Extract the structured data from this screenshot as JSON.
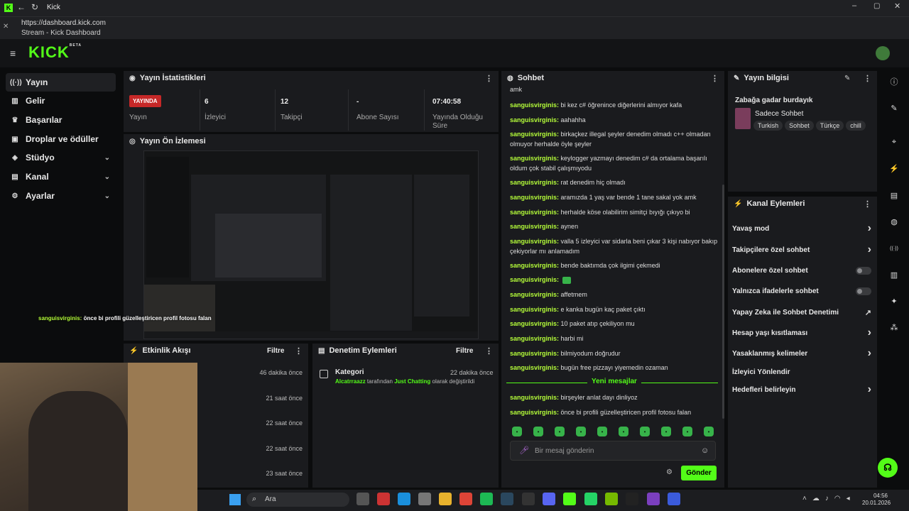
{
  "browser": {
    "tab_title": "Kick",
    "url": "https://dashboard.kick.com",
    "page_title": "Stream - Kick Dashboard"
  },
  "brand": {
    "logo": "KICK",
    "logo_sup": "BETA",
    "accent": "#53fc18"
  },
  "sidebar": {
    "items": [
      {
        "label": "Yayın",
        "icon": "broadcast-icon",
        "active": true
      },
      {
        "label": "Gelir",
        "icon": "money-icon"
      },
      {
        "label": "Başarılar",
        "icon": "trophy-icon"
      },
      {
        "label": "Droplar ve ödüller",
        "icon": "gift-icon"
      },
      {
        "label": "Stüdyo",
        "icon": "studio-icon",
        "expandable": true
      },
      {
        "label": "Kanal",
        "icon": "channel-icon",
        "expandable": true
      },
      {
        "label": "Ayarlar",
        "icon": "gear-icon",
        "expandable": true
      }
    ]
  },
  "stats": {
    "title": "Yayın İstatistikleri",
    "live_badge": "YAYINDA",
    "live_label": "Yayın",
    "items": [
      {
        "value": "6",
        "label": "İzleyici"
      },
      {
        "value": "12",
        "label": "Takipçi"
      },
      {
        "value": "-",
        "label": "Abone Sayısı"
      },
      {
        "value": "07:40:58",
        "label": "Yayında Olduğu Süre"
      }
    ]
  },
  "preview": {
    "title": "Yayın Ön İzlemesi",
    "overlay_user": "sanguisvirginis:",
    "overlay_text": "önce bi profili güzelleştiricen profil fotosu falan"
  },
  "activity": {
    "title": "Etkinlik Akışı",
    "filter": "Filtre",
    "times": [
      "46 dakika önce",
      "21 saat önce",
      "22 saat önce",
      "22 saat önce",
      "23 saat önce"
    ]
  },
  "moderation": {
    "title": "Denetim Eylemleri",
    "filter": "Filtre",
    "item_title": "Kategori",
    "item_time": "22 dakika önce",
    "actor": "Alcatrraazz",
    "mid": "tarafından",
    "target": "Just Chatting",
    "tail": "olarak değiştirildi"
  },
  "chat": {
    "title": "Sohbet",
    "first_line": "amk",
    "messages": [
      {
        "user": "sanguisvirginis:",
        "text": "bi kez c# öğrenince diğerlerini almıyor kafa"
      },
      {
        "user": "sanguisvirginis:",
        "text": "aahahha"
      },
      {
        "user": "sanguisvirginis:",
        "text": "birkaçkez illegal şeyler denedim olmadı c++ olmadan olmuyor herhalde öyle şeyler"
      },
      {
        "user": "sanguisvirginis:",
        "text": "keylogger yazmayı denedim c# da ortalama başarılı oldum çok stabil çalışmıyodu"
      },
      {
        "user": "sanguisvirginis:",
        "text": "rat denedim hiç olmadı"
      },
      {
        "user": "sanguisvirginis:",
        "text": "aramızda 1 yaş var bende 1 tane sakal yok amk"
      },
      {
        "user": "sanguisvirginis:",
        "text": "herhalde köse olabilirim simitçi bıyığı çıkıyo bi"
      },
      {
        "user": "sanguisvirginis:",
        "text": "aynen"
      },
      {
        "user": "sanguisvirginis:",
        "text": "valla 5 izleyici var sidarla beni çıkar 3 kişi nabıyor bakıp çekiyorlar mı anlamadım"
      },
      {
        "user": "sanguisvirginis:",
        "text": "bende baktımda çok ilgimi çekmedi"
      },
      {
        "user": "sanguisvirginis:",
        "text": ""
      },
      {
        "user": "sanguisvirginis:",
        "text": "affetmem"
      },
      {
        "user": "sanguisvirginis:",
        "text": "e kanka bugün kaç paket çıktı"
      },
      {
        "user": "sanguisvirginis:",
        "text": "10 paket atıp çekiliyon mu"
      },
      {
        "user": "sanguisvirginis:",
        "text": "harbi mi"
      },
      {
        "user": "sanguisvirginis:",
        "text": "bilmiyodum doğrudur"
      },
      {
        "user": "sanguisvirginis:",
        "text": "bugün free pizzayı yiyemedin ozaman"
      }
    ],
    "new_divider": "Yeni mesajlar",
    "new_messages": [
      {
        "user": "sanguisvirginis:",
        "text": "birşeyler anlat dayı dinliyoz"
      },
      {
        "user": "sanguisvirginis:",
        "text": "önce bi profili güzelleştiricen profil fotosu falan"
      }
    ],
    "placeholder": "Bir mesaj gönderin",
    "send": "Gönder"
  },
  "info": {
    "title": "Yayın bilgisi",
    "stream_title": "Zabağa gadar burdayık",
    "category": "Sadece Sohbet",
    "tags": [
      "Turkish",
      "Sohbet",
      "Türkçe",
      "chill"
    ]
  },
  "actions": {
    "title": "Kanal Eylemleri",
    "items": [
      {
        "label": "Yavaş mod",
        "kind": "chevron"
      },
      {
        "label": "Takipçilere özel sohbet",
        "kind": "chevron"
      },
      {
        "label": "Abonelere özel sohbet",
        "kind": "toggle"
      },
      {
        "label": "Yalnızca ifadelerle sohbet",
        "kind": "toggle"
      },
      {
        "label": "Yapay Zeka ile Sohbet Denetimi",
        "kind": "external"
      },
      {
        "label": "Hesap yaşı kısıtlaması",
        "kind": "chevron"
      },
      {
        "label": "Yasaklanmış kelimeler",
        "kind": "chevron"
      },
      {
        "label": "İzleyici Yönlendir",
        "kind": "none"
      },
      {
        "label": "Hedefleri belirleyin",
        "kind": "chevron"
      }
    ]
  },
  "taskbar": {
    "search": "Ara",
    "time": "04:56",
    "date": "20.01.2026"
  }
}
